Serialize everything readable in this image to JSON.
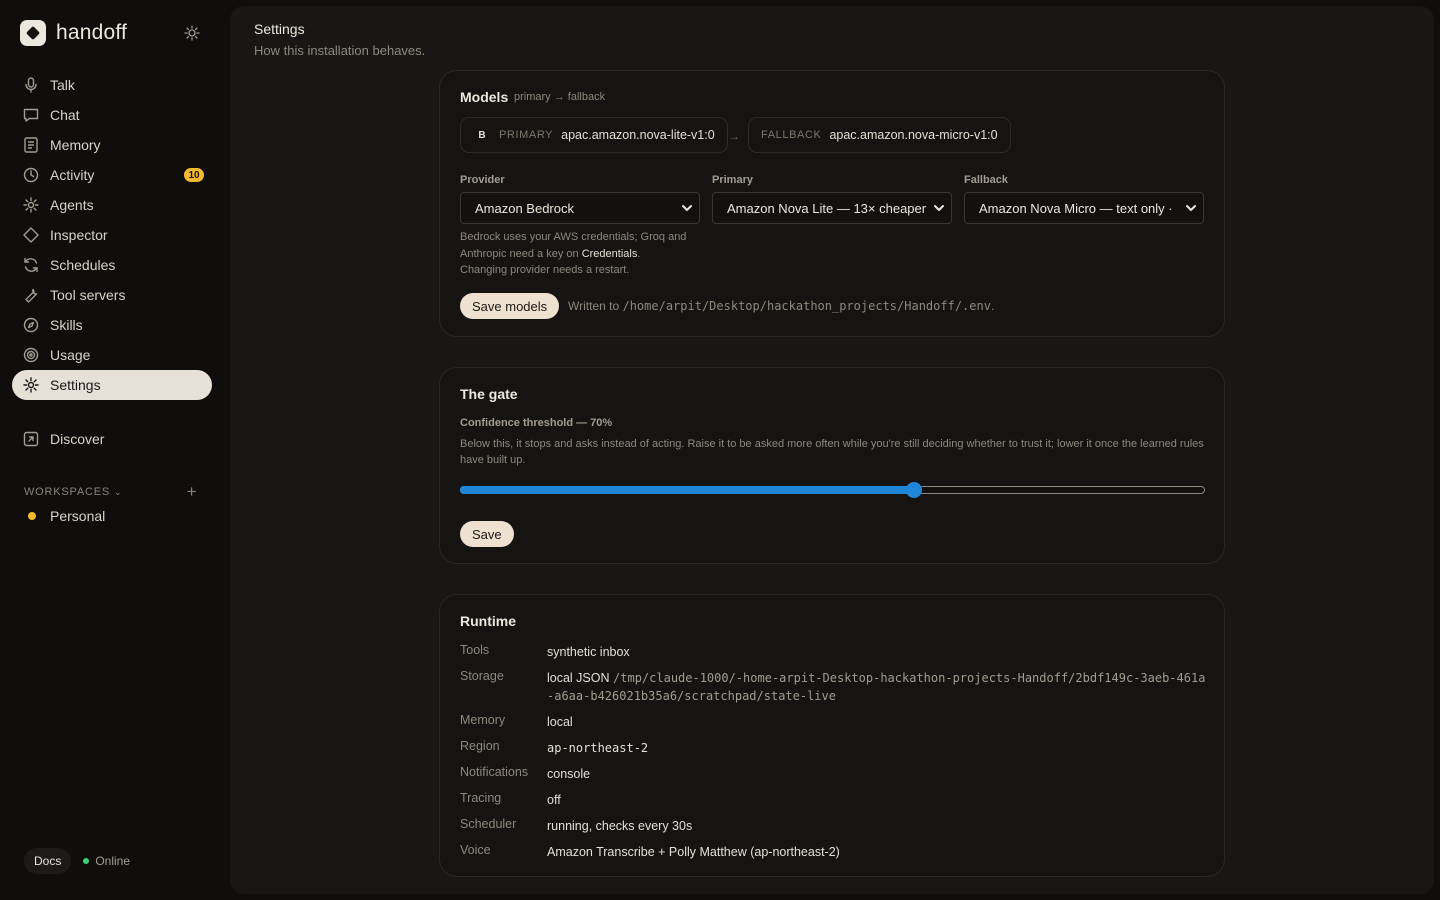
{
  "brand": {
    "name": "handoff"
  },
  "nav": [
    {
      "label": "Talk",
      "icon": "mic-icon"
    },
    {
      "label": "Chat",
      "icon": "chat-icon"
    },
    {
      "label": "Memory",
      "icon": "memory-icon"
    },
    {
      "label": "Activity",
      "icon": "clock-icon",
      "badge": "10"
    },
    {
      "label": "Agents",
      "icon": "agents-icon"
    },
    {
      "label": "Inspector",
      "icon": "diamond-icon"
    },
    {
      "label": "Schedules",
      "icon": "refresh-icon"
    },
    {
      "label": "Tool servers",
      "icon": "wrench-icon"
    },
    {
      "label": "Skills",
      "icon": "compass-icon"
    },
    {
      "label": "Usage",
      "icon": "target-icon"
    },
    {
      "label": "Settings",
      "icon": "gear-icon",
      "active": true
    }
  ],
  "discover": {
    "label": "Discover",
    "icon": "external-link-icon"
  },
  "workspaces": {
    "heading": "WORKSPACES",
    "items": [
      {
        "label": "Personal"
      }
    ]
  },
  "footer": {
    "docs": "Docs",
    "status": "Online"
  },
  "page": {
    "title": "Settings",
    "subtitle": "How this installation behaves."
  },
  "models": {
    "title": "Models",
    "sub": "primary → fallback",
    "primary_chip": {
      "badge": "B",
      "tag": "PRIMARY",
      "value": "apac.amazon.nova-lite-v1:0"
    },
    "fallback_chip": {
      "tag": "FALLBACK",
      "value": "apac.amazon.nova-micro-v1:0"
    },
    "arrow": "→",
    "provider": {
      "label": "Provider",
      "value": "Amazon Bedrock"
    },
    "primary": {
      "label": "Primary",
      "value": "Amazon Nova Lite — 13× cheaper"
    },
    "fallback": {
      "label": "Fallback",
      "value": "Amazon Nova Micro — text only ·"
    },
    "help_1": "Bedrock uses your AWS credentials; Groq and Anthropic need a key on",
    "help_link": "Credentials",
    "help_period": ".",
    "help_2": "Changing provider needs a restart.",
    "save_label": "Save models",
    "written_prefix": "Written to",
    "written_path": "/home/arpit/Desktop/hackathon_projects/Handoff/.env",
    "written_suffix": "."
  },
  "gate": {
    "title": "The gate",
    "threshold_label": "Confidence threshold — 70%",
    "threshold_value": 0.61,
    "description": "Below this, it stops and asks instead of acting. Raise it to be asked more often while you're still deciding whether to trust it; lower it once the learned rules have built up.",
    "save_label": "Save"
  },
  "runtime": {
    "title": "Runtime",
    "rows": {
      "tools": {
        "key": "Tools",
        "value": "synthetic inbox"
      },
      "storage": {
        "key": "Storage",
        "value": "local JSON",
        "path": "/tmp/claude-1000/-home-arpit-Desktop-hackathon-projects-Handoff/2bdf149c-3aeb-461a-a6aa-b426021b35a6/scratchpad/state-live"
      },
      "memory": {
        "key": "Memory",
        "value": "local"
      },
      "region": {
        "key": "Region",
        "value": "ap-northeast-2"
      },
      "notifications": {
        "key": "Notifications",
        "value": "console"
      },
      "tracing": {
        "key": "Tracing",
        "value": "off"
      },
      "scheduler": {
        "key": "Scheduler",
        "value": "running, checks every 30s"
      },
      "voice": {
        "key": "Voice",
        "value": "Amazon Transcribe + Polly Matthew (ap-northeast-2)"
      }
    }
  },
  "colors": {
    "accent": "#1f86d8",
    "badge": "#f2b92e",
    "online": "#3ecf72",
    "pill": "#efe1cf"
  }
}
